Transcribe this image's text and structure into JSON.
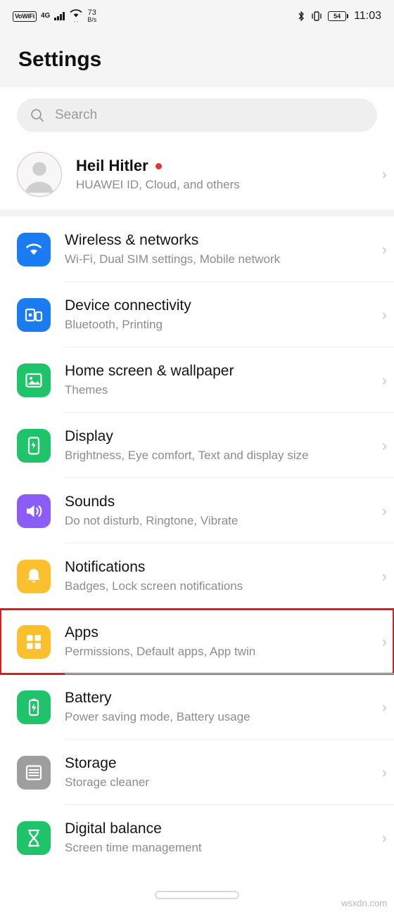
{
  "status_bar": {
    "volte_label": "VoWiFi",
    "network_type": "4G",
    "signal_sub": "ıl",
    "wifi_sub": "⁜",
    "speed_value": "73",
    "speed_unit": "B/s",
    "bluetooth_icon": "bluetooth-icon",
    "vibrate_icon": "vibrate-icon",
    "battery_level": "54",
    "clock": "11:03"
  },
  "header": {
    "title": "Settings"
  },
  "search": {
    "placeholder": "Search",
    "icon": "search-icon"
  },
  "account": {
    "name": "Heil Hitler",
    "has_badge": true,
    "subtitle": "HUAWEI ID, Cloud, and others",
    "avatar_icon": "avatar-icon",
    "chevron": "›"
  },
  "settings_items": [
    {
      "id": "wireless-networks",
      "title": "Wireless & networks",
      "subtitle": "Wi-Fi, Dual SIM settings, Mobile network",
      "icon": "wifi-icon",
      "icon_bg": "#1a7cf0",
      "highlighted": false
    },
    {
      "id": "device-connectivity",
      "title": "Device connectivity",
      "subtitle": "Bluetooth, Printing",
      "icon": "device-connect-icon",
      "icon_bg": "#1a7cf0",
      "highlighted": false
    },
    {
      "id": "home-screen-wallpaper",
      "title": "Home screen & wallpaper",
      "subtitle": "Themes",
      "icon": "image-icon",
      "icon_bg": "#1fc36a",
      "highlighted": false
    },
    {
      "id": "display",
      "title": "Display",
      "subtitle": "Brightness, Eye comfort, Text and display size",
      "icon": "display-icon",
      "icon_bg": "#1fc36a",
      "highlighted": false
    },
    {
      "id": "sounds",
      "title": "Sounds",
      "subtitle": "Do not disturb, Ringtone, Vibrate",
      "icon": "speaker-icon",
      "icon_bg": "#8b5cf6",
      "highlighted": false
    },
    {
      "id": "notifications",
      "title": "Notifications",
      "subtitle": "Badges, Lock screen notifications",
      "icon": "bell-icon",
      "icon_bg": "#fbc02d",
      "highlighted": false
    },
    {
      "id": "apps",
      "title": "Apps",
      "subtitle": "Permissions, Default apps, App twin",
      "icon": "apps-grid-icon",
      "icon_bg": "#fbc02d",
      "highlighted": true
    },
    {
      "id": "battery",
      "title": "Battery",
      "subtitle": "Power saving mode, Battery usage",
      "icon": "battery-icon",
      "icon_bg": "#1fc36a",
      "highlighted": false
    },
    {
      "id": "storage",
      "title": "Storage",
      "subtitle": "Storage cleaner",
      "icon": "storage-icon",
      "icon_bg": "#9e9e9e",
      "highlighted": false
    },
    {
      "id": "digital-balance",
      "title": "Digital balance",
      "subtitle": "Screen time management",
      "icon": "hourglass-icon",
      "icon_bg": "#1fc36a",
      "highlighted": false
    }
  ],
  "nav_bar": {
    "pill": "home-indicator"
  },
  "watermark": "wsxdn.com",
  "colors": {
    "accent_red": "#d81f1f",
    "badge_red": "#e8352d",
    "subtitle_gray": "#8c8c8c",
    "bg_gray": "#f5f5f5"
  }
}
